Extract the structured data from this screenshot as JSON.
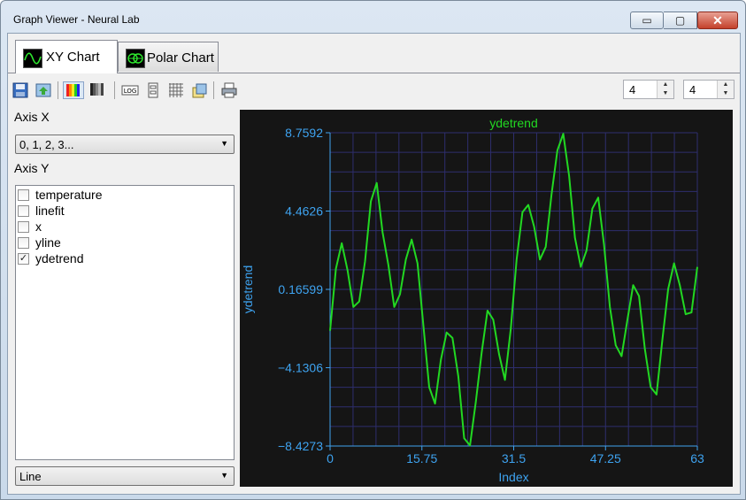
{
  "window": {
    "title": "Graph Viewer - Neural Lab",
    "min_glyph": "▭",
    "max_glyph": "▢",
    "close_glyph": "✕"
  },
  "tabs": [
    {
      "label": "XY Chart",
      "active": true
    },
    {
      "label": "Polar Chart",
      "active": false
    }
  ],
  "toolbar": {
    "icons": [
      "save-icon",
      "export-icon",
      "color-palette-icon",
      "grayscale-icon",
      "log-scale-icon",
      "scale-icon",
      "grid-icon",
      "copy-icon",
      "print-icon"
    ],
    "spin1": "4",
    "spin2": "4"
  },
  "axis_x": {
    "label": "Axis X",
    "selected": "0, 1, 2, 3..."
  },
  "axis_y": {
    "label": "Axis Y",
    "items": [
      {
        "label": "temperature",
        "checked": false
      },
      {
        "label": "linefit",
        "checked": false
      },
      {
        "label": "x",
        "checked": false
      },
      {
        "label": "yline",
        "checked": false
      },
      {
        "label": "ydetrend",
        "checked": true
      }
    ]
  },
  "plot_type": {
    "selected": "Line"
  },
  "colors": {
    "plot_bg": "#151515",
    "grid": "#2e2e6e",
    "axis_text": "#3ea3f0",
    "line": "#22d822",
    "title": "#22d822"
  },
  "chart_data": {
    "type": "line",
    "title": "ydetrend",
    "xlabel": "Index",
    "ylabel": "ydetrend",
    "xlim": [
      0,
      63
    ],
    "ylim": [
      -8.4273,
      8.7592
    ],
    "x_ticks": [
      "0",
      "15.75",
      "31.5",
      "47.25",
      "63"
    ],
    "y_ticks": [
      "8.7592",
      "4.4626",
      "0.16599",
      "−4.1306",
      "−8.4273"
    ],
    "grid": true,
    "series": [
      {
        "name": "ydetrend",
        "x": [
          0,
          1,
          2,
          3,
          4,
          5,
          6,
          7,
          8,
          9,
          10,
          11,
          12,
          13,
          14,
          15,
          16,
          17,
          18,
          19,
          20,
          21,
          22,
          23,
          24,
          25,
          26,
          27,
          28,
          29,
          30,
          31,
          32,
          33,
          34,
          35,
          36,
          37,
          38,
          39,
          40,
          41,
          42,
          43,
          44,
          45,
          46,
          47,
          48,
          49,
          50,
          51,
          52,
          53,
          54,
          55,
          56,
          57,
          58,
          59,
          60,
          61,
          62,
          63
        ],
        "y": [
          -2.1,
          1.3,
          2.7,
          1.2,
          -0.8,
          -0.5,
          1.7,
          5.0,
          6.0,
          3.3,
          1.5,
          -0.8,
          -0.1,
          1.8,
          2.9,
          1.6,
          -1.8,
          -5.2,
          -6.1,
          -3.7,
          -2.2,
          -2.5,
          -4.6,
          -8.0,
          -8.4,
          -6.0,
          -3.3,
          -1.0,
          -1.5,
          -3.4,
          -4.8,
          -2.0,
          1.8,
          4.4,
          4.8,
          3.6,
          1.8,
          2.5,
          5.4,
          7.8,
          8.7,
          6.4,
          3.0,
          1.4,
          2.3,
          4.6,
          5.2,
          2.6,
          -0.8,
          -2.9,
          -3.5,
          -1.5,
          0.4,
          -0.2,
          -3.1,
          -5.2,
          -5.6,
          -2.6,
          0.2,
          1.6,
          0.4,
          -1.2,
          -1.1,
          1.4
        ]
      }
    ]
  }
}
